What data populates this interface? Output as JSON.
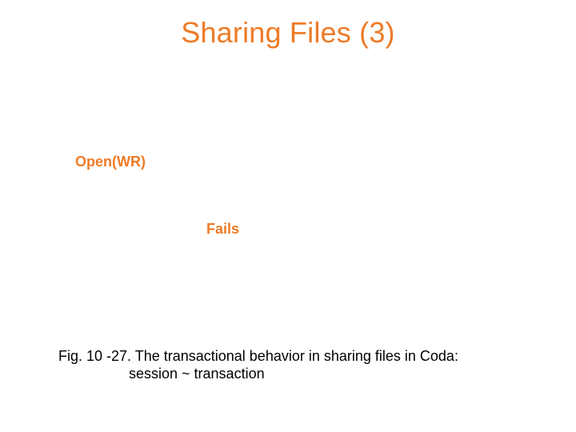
{
  "title": "Sharing Files (3)",
  "labels": {
    "openwr": "Open(WR)",
    "fails": "Fails"
  },
  "caption": {
    "line1": "Fig. 10 -27. The transactional behavior in sharing files in Coda:",
    "line2": "session ~ transaction"
  }
}
